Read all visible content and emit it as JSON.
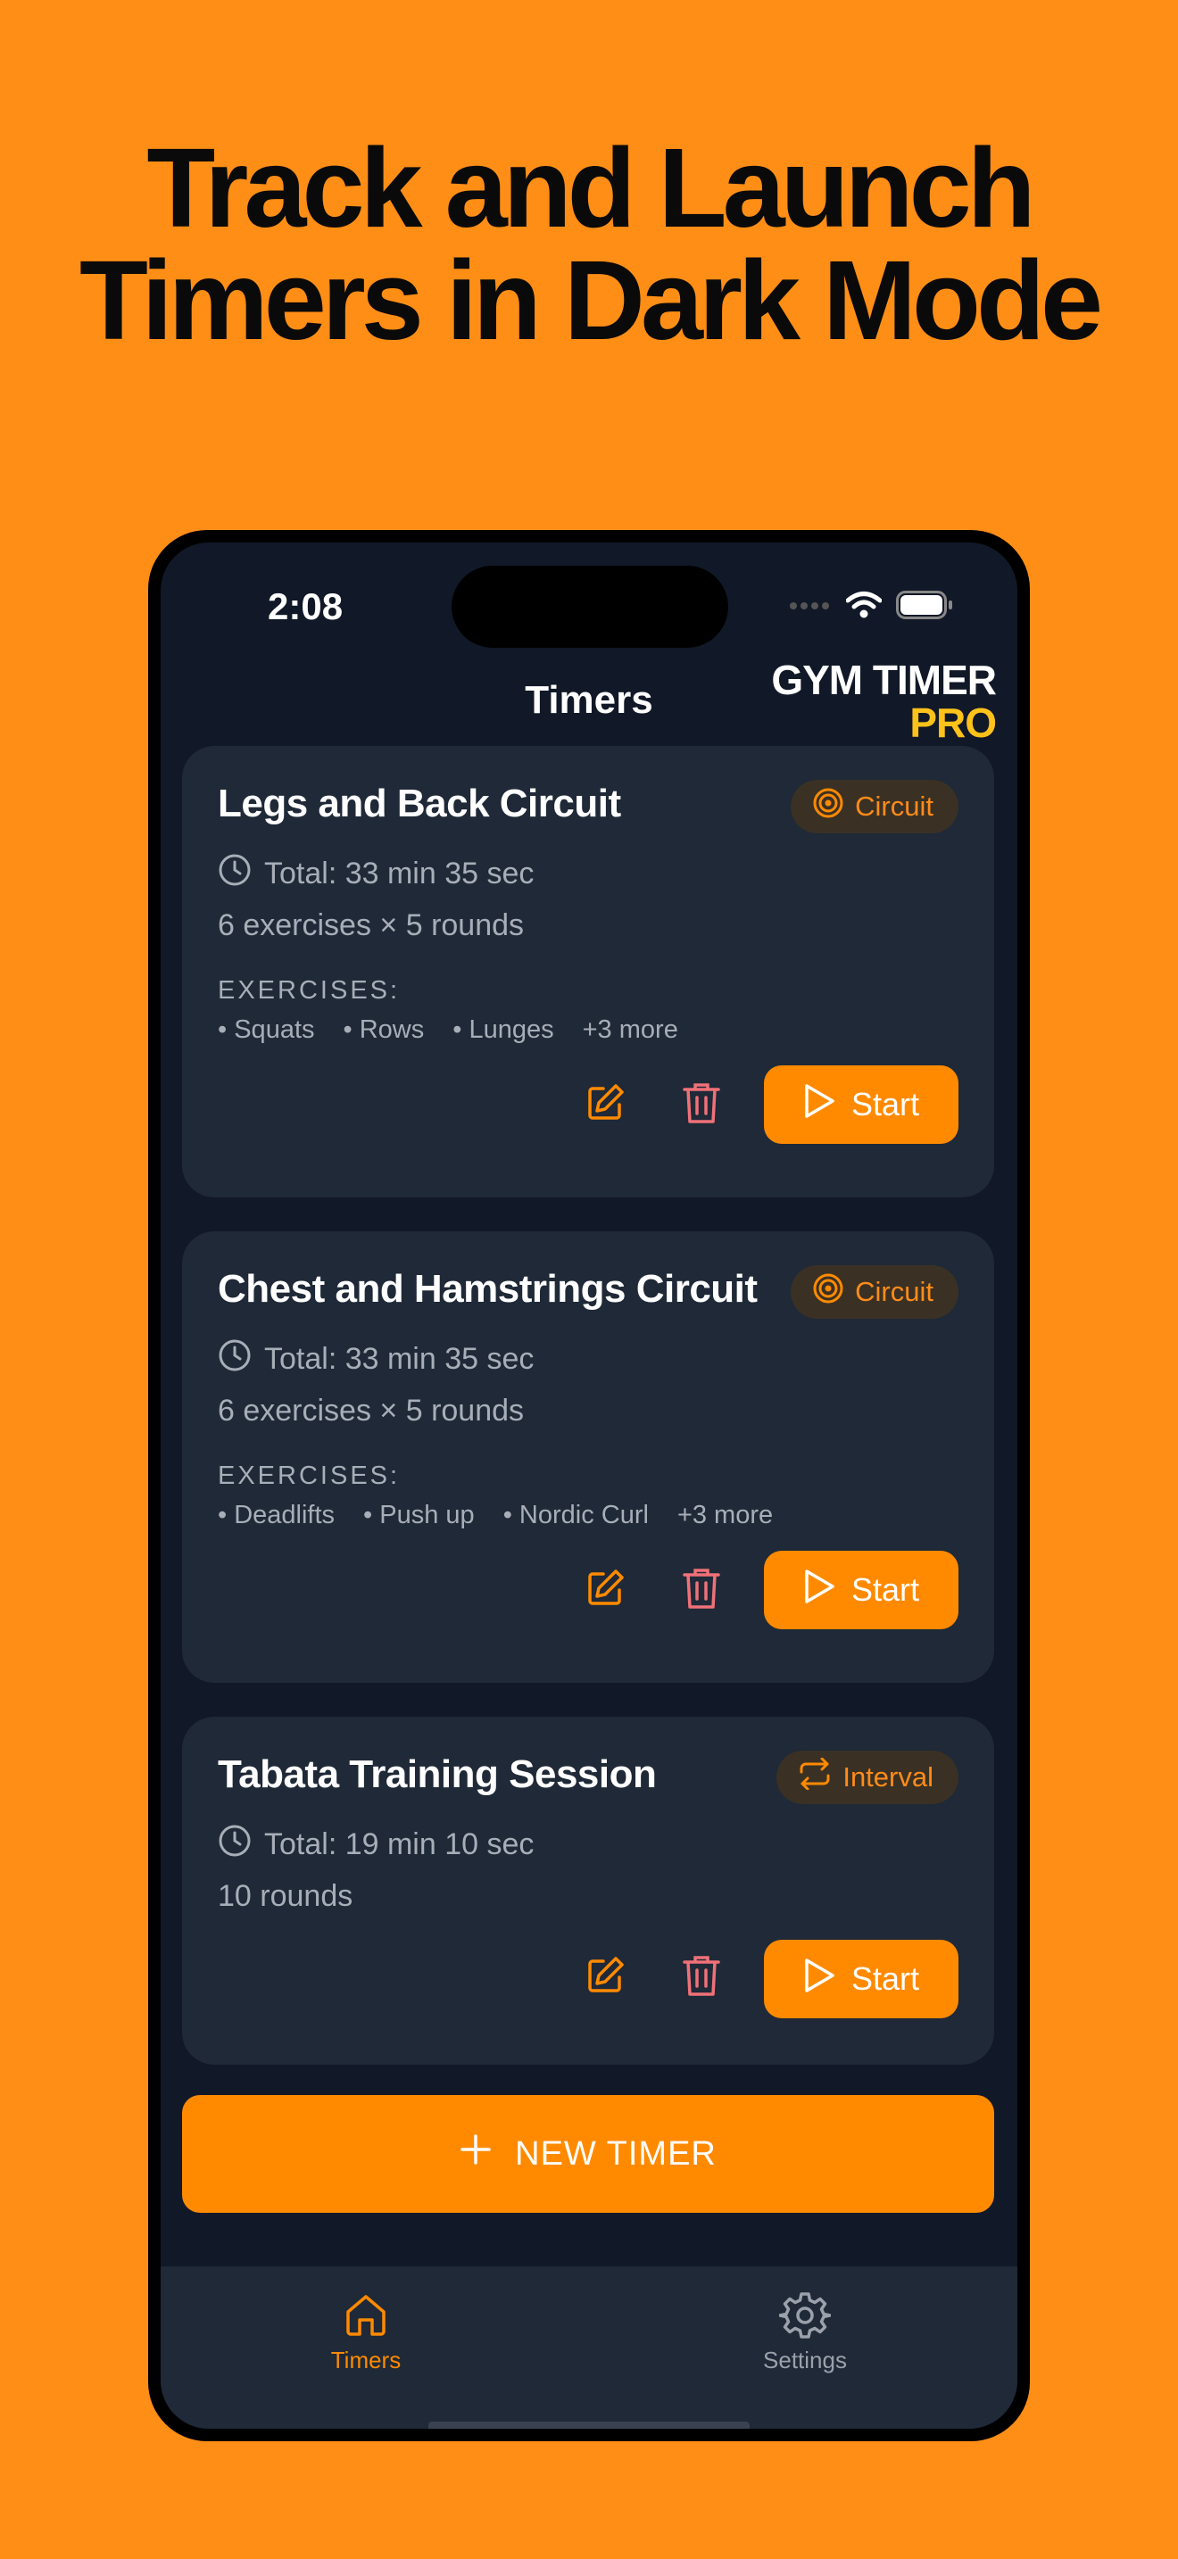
{
  "headline": {
    "line1": "Track and Launch",
    "line2": "Timers in Dark Mode"
  },
  "status": {
    "time": "2:08"
  },
  "nav": {
    "title": "Timers"
  },
  "brand": {
    "line1": "GYM TIMER",
    "line2": "PRO"
  },
  "cards": [
    {
      "title": "Legs and Back Circuit",
      "tag": "Circuit",
      "total": "Total: 33 min 35 sec",
      "summary": "6 exercises × 5 rounds",
      "exercises_label": "EXERCISES:",
      "exercises": [
        "Squats",
        "Rows",
        "Lunges"
      ],
      "more": "+3 more",
      "start": "Start"
    },
    {
      "title": "Chest and Hamstrings Circuit",
      "tag": "Circuit",
      "total": "Total: 33 min 35 sec",
      "summary": "6 exercises × 5 rounds",
      "exercises_label": "EXERCISES:",
      "exercises": [
        "Deadlifts",
        "Push up",
        "Nordic Curl"
      ],
      "more": "+3 more",
      "start": "Start"
    },
    {
      "title": "Tabata Training Session",
      "tag": "Interval",
      "total": "Total: 19 min 10 sec",
      "summary": "10 rounds",
      "start": "Start"
    }
  ],
  "new_timer": "NEW TIMER",
  "tabs": {
    "timers": "Timers",
    "settings": "Settings"
  },
  "colors": {
    "background": "#FF8E16",
    "accent": "#FF8A00",
    "screen": "#111827",
    "card": "#1F2937",
    "brand_pro": "#FFC21A",
    "delete": "#F07178"
  },
  "icons": [
    "clock-icon",
    "target-icon",
    "repeat-icon",
    "edit-icon",
    "trash-icon",
    "play-icon",
    "plus-icon",
    "home-icon",
    "gear-icon",
    "wifi-icon",
    "battery-icon"
  ]
}
